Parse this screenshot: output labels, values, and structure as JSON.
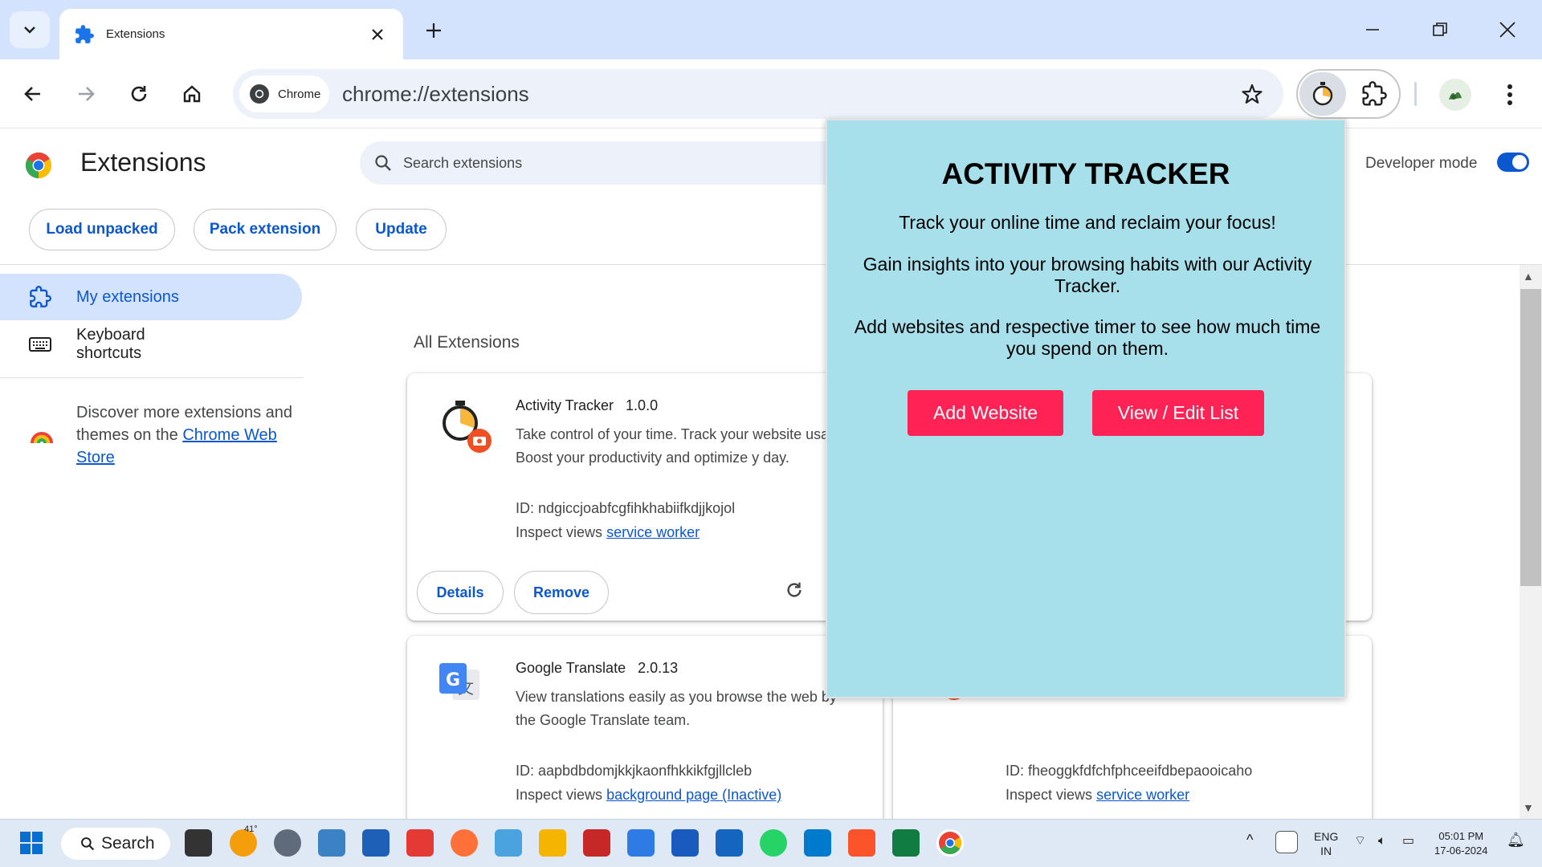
{
  "browser": {
    "tab_title": "Extensions",
    "chip_label": "Chrome",
    "url": "chrome://extensions"
  },
  "page": {
    "title": "Extensions",
    "search_placeholder": "Search extensions",
    "developer_mode_label": "Developer mode",
    "developer_mode_on": true,
    "buttons": {
      "load_unpacked": "Load unpacked",
      "pack_extension": "Pack extension",
      "update": "Update"
    },
    "sidebar": {
      "my_extensions": "My extensions",
      "keyboard_shortcuts": "Keyboard shortcuts",
      "discover_text": "Discover more extensions and themes on the",
      "discover_link": "Chrome Web Store"
    },
    "section_title": "All Extensions",
    "cards": [
      {
        "name": "Activity Tracker",
        "version": "1.0.0",
        "description": "Take control of your time. Track your website usage. Boost your productivity and optimize y day.",
        "id_label": "ID: ndgiccjoabfcgfihkhabiifkdjjkojol",
        "inspect_label": "Inspect views",
        "inspect_link": "service worker",
        "details": "Details",
        "remove": "Remove"
      },
      {
        "name": "Google Translate",
        "version": "2.0.13",
        "description": "View translations easily as you browse the web by the Google Translate team.",
        "id_label": "ID: aapbdbdomjkkjkaonfhkkikfgjllcleb",
        "inspect_label": "Inspect views",
        "inspect_link": "background page (Inactive)"
      },
      {
        "id_label": "ID: fheoggkfdfchfphceeifdbepaooicaho",
        "inspect_label": "Inspect views",
        "inspect_link": "service worker"
      }
    ]
  },
  "popup": {
    "title": "ACTIVITY TRACKER",
    "line1": "Track your online time and reclaim your focus!",
    "line2": "Gain insights into your browsing habits with our Activity Tracker.",
    "line3": "Add websites and respective timer to see how much time you spend on them.",
    "add_button": "Add Website",
    "view_button": "View / Edit List",
    "background_color": "#a7dfeb",
    "button_color": "#ff2255"
  },
  "taskbar": {
    "search_label": "Search",
    "weather_temp": "41°",
    "lang_line1": "ENG",
    "lang_line2": "IN",
    "time": "05:01 PM",
    "date": "17-06-2024"
  },
  "colors": {
    "accent": "#0b57d0",
    "titlebar": "#d3e3fd"
  }
}
